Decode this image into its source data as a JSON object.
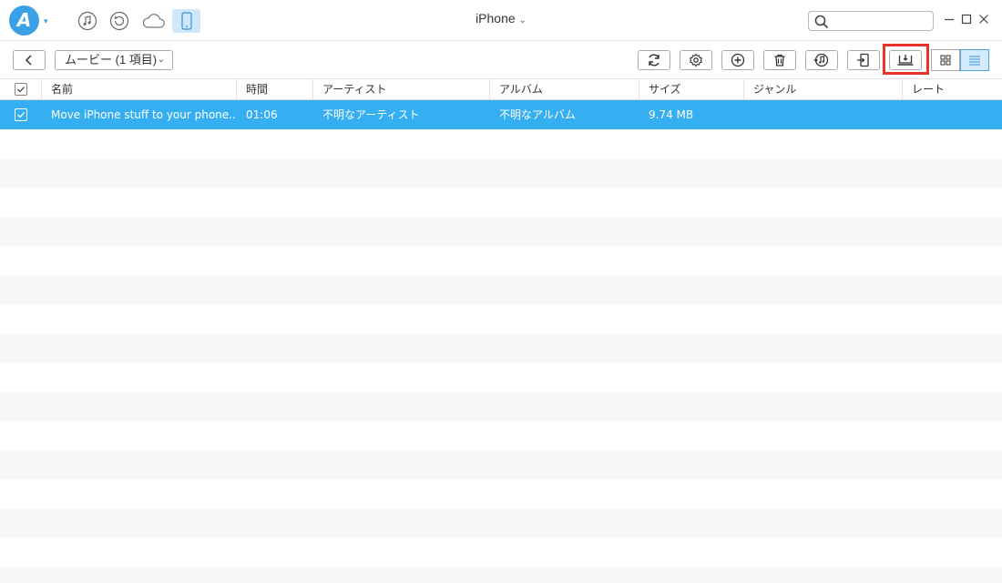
{
  "app": {
    "logo_letter": "A",
    "device_title": "iPhone"
  },
  "nav": [
    "music-note-icon",
    "history-icon",
    "cloud-icon",
    "phone-icon"
  ],
  "search": {
    "placeholder": ""
  },
  "toolbar": {
    "category_label": "ムービー (1 項目)",
    "buttons": [
      "refresh-icon",
      "settings-icon",
      "add-icon",
      "delete-icon",
      "to-itunes-icon",
      "to-device-icon",
      "to-computer-icon"
    ],
    "highlighted_button": "to-computer-icon"
  },
  "table": {
    "columns": [
      "名前",
      "時間",
      "アーティスト",
      "アルバム",
      "サイズ",
      "ジャンル",
      "レート"
    ],
    "rows": [
      {
        "name": "Move iPhone stuff to your phone...",
        "time": "01:06",
        "artist": "不明なアーティスト",
        "album": "不明なアルバム",
        "size": "9.74 MB",
        "genre": "",
        "rate": "",
        "selected": true
      }
    ]
  },
  "colors": {
    "accent": "#36aef2",
    "highlight": "#e8322a",
    "brand": "#3aa1e6"
  }
}
